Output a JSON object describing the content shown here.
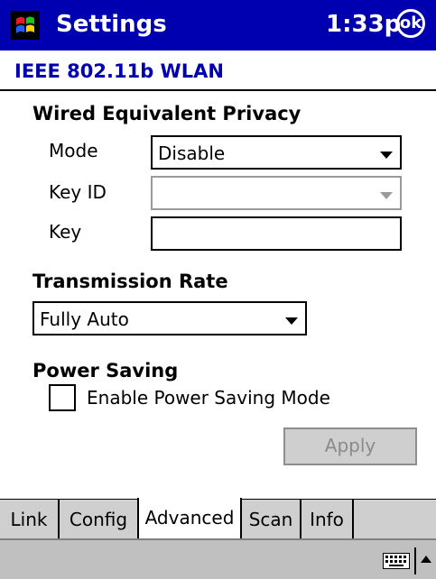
{
  "titlebar": {
    "start_icon": "windows-flag-icon",
    "title": "Settings",
    "clock": "1:33p",
    "ok_label": "ok"
  },
  "page": {
    "heading": "IEEE 802.11b WLAN"
  },
  "wep": {
    "section_title": "Wired Equivalent Privacy",
    "mode_label": "Mode",
    "mode_value": "Disable",
    "keyid_label": "Key ID",
    "keyid_value": "",
    "key_label": "Key",
    "key_value": ""
  },
  "transmission": {
    "section_title": "Transmission Rate",
    "rate_value": "Fully Auto"
  },
  "power": {
    "section_title": "Power Saving",
    "checkbox_label": "Enable Power Saving Mode",
    "checked": false
  },
  "apply_label": "Apply",
  "tabs": [
    "Link",
    "Config",
    "Advanced",
    "Scan",
    "Info"
  ],
  "active_tab": "Advanced",
  "menubar": {
    "keyboard_icon": "keyboard-icon",
    "sip_arrow": "up-arrow-icon"
  },
  "colors": {
    "titlebar": "#0000b0",
    "heading": "#0000b0",
    "chrome": "#cfcfcf"
  }
}
